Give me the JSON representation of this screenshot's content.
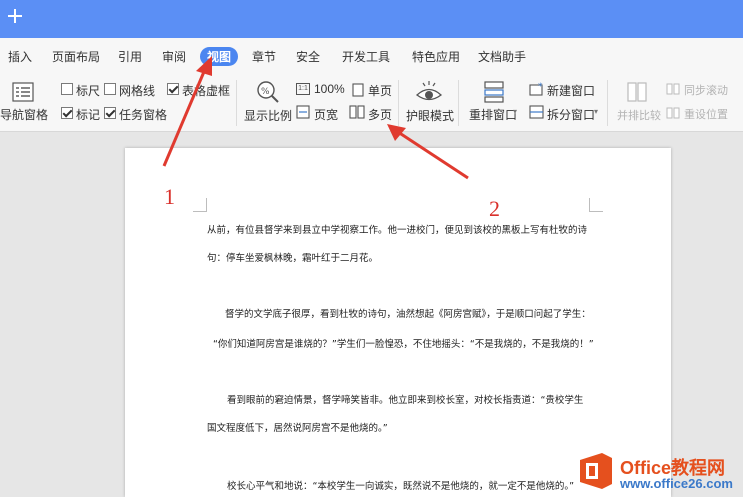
{
  "menubar": {
    "items": [
      "插入",
      "页面布局",
      "引用",
      "审阅",
      "视图",
      "章节",
      "安全",
      "开发工具",
      "特色应用",
      "文档助手"
    ]
  },
  "ribbon": {
    "nav_pane": "导航窗格",
    "ruler": "标尺",
    "gridlines": "网格线",
    "table_gridlines": "表格虚框",
    "marks": "标记",
    "task_pane": "任务窗格",
    "zoom": "显示比例",
    "zoom_100": "100%",
    "page_width": "页宽",
    "single_page": "单页",
    "multi_page": "多页",
    "eye_protect": "护眼模式",
    "arrange_windows": "重排窗口",
    "new_window": "新建窗口",
    "split_window": "拆分窗口",
    "side_by_side": "并排比较",
    "sync_scroll": "同步滚动",
    "reset_position": "重设位置"
  },
  "checkboxes": {
    "ruler": false,
    "gridlines": false,
    "table_gridlines": true,
    "marks": true,
    "task_pane": true
  },
  "annotations": {
    "one": "1",
    "two": "2"
  },
  "document": {
    "lines": [
      "从前，有位县督学来到县立中学视察工作。他一进校门，便见到该校的黑板上写有杜牧的诗",
      "句：停车坐爱枫林晚，霜叶红于二月花。",
      "督学的文学底子很厚，看到杜牧的诗句，油然想起《阿房宫赋》，于是顺口问起了学生：",
      "“你们知道阿房宫是谁烧的？”学生们一脸惶恐，不住地摇头：“不是我烧的，不是我烧的！”",
      "看到眼前的窘迫情景，督学啼笑皆非。他立即来到校长室，对校长指责道：“贵校学生",
      "国文程度低下，居然说阿房宫不是他烧的。”",
      "校长心平气和地说：“本校学生一向诚实，既然说不是他烧的，就一定不是他烧的。”"
    ]
  },
  "watermark": {
    "title": "Office教程网",
    "url": "www.office26.com"
  },
  "colors": {
    "topbar": "#5b8ff5",
    "active_tab": "#4b86f0",
    "annotation": "#d9302b"
  }
}
